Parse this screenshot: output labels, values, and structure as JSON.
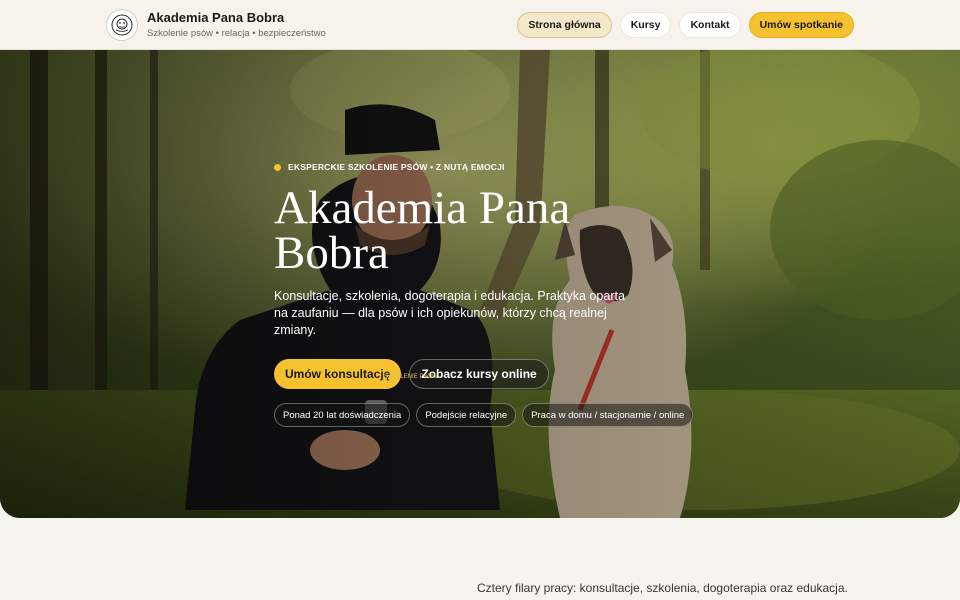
{
  "header": {
    "brand_title": "Akademia Pana Bobra",
    "brand_subtitle": "Szkolenie psów • relacja • bezpieczeństwo",
    "nav": [
      {
        "label": "Strona główna",
        "active": true
      },
      {
        "label": "Kursy"
      },
      {
        "label": "Kontakt"
      },
      {
        "label": "Umów spotkanie",
        "cta": true
      }
    ]
  },
  "hero": {
    "eyebrow": "EKSPERCKIE SZKOLENIE PSÓW • Z NUTĄ EMOCJI",
    "title": "Akademia Pana Bobra",
    "description": "Konsultacje, szkolenia, dogoterapia i edukacja. Praktyka oparta na zaufaniu — dla psów i ich opiekunów, którzy chcą realnej zmiany.",
    "primary_button": "Umów konsultację",
    "secondary_button": "Zobacz kursy online",
    "chips": [
      "Ponad 20 lat doświadczenia",
      "Podejście relacyjne",
      "Praca w domu / stacjonarnie / online"
    ],
    "shirt_text": "SZKOLENIE PSÓW"
  },
  "section": {
    "intro": "Cztery filary pracy: konsultacje, szkolenia, dogoterapia oraz edukacja."
  },
  "colors": {
    "accent": "#f5c12e",
    "background": "#f6f4ef"
  }
}
